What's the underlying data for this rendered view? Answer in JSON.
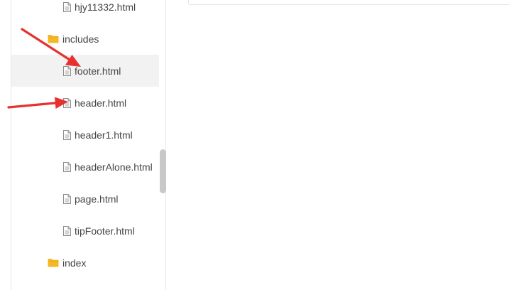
{
  "file_tree": {
    "items": [
      {
        "type": "file",
        "label": "hjy11332.html",
        "icon": "file-icon"
      },
      {
        "type": "folder",
        "label": "includes",
        "icon": "folder-icon"
      },
      {
        "type": "file",
        "label": "footer.html",
        "icon": "file-icon",
        "selected": true
      },
      {
        "type": "file",
        "label": "header.html",
        "icon": "file-icon"
      },
      {
        "type": "file",
        "label": "header1.html",
        "icon": "file-icon"
      },
      {
        "type": "file",
        "label": "headerAlone.html",
        "icon": "file-icon"
      },
      {
        "type": "file",
        "label": "page.html",
        "icon": "file-icon"
      },
      {
        "type": "file",
        "label": "tipFooter.html",
        "icon": "file-icon"
      },
      {
        "type": "folder",
        "label": "index",
        "icon": "folder-icon"
      }
    ]
  },
  "colors": {
    "folder": "#f5b726",
    "file_icon": "#8c8c8c",
    "selected_row": "#f2f2f2",
    "annotation_arrow": "#e8312f",
    "text": "#444444"
  },
  "annotations": {
    "arrows": [
      "arrow-to-footer",
      "arrow-to-header"
    ]
  }
}
